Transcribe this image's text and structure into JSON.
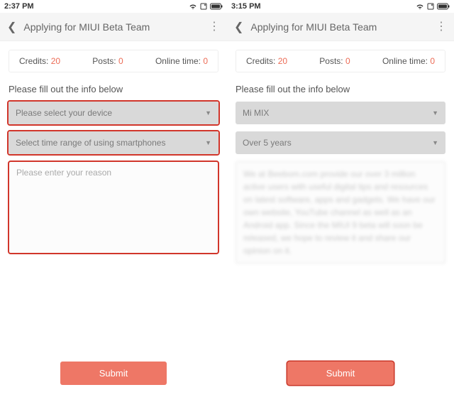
{
  "left": {
    "statusbar": {
      "time": "2:37 PM"
    },
    "header": {
      "title": "Applying for MIUI Beta Team"
    },
    "stats": {
      "credits_label": "Credits:",
      "credits_value": "20",
      "posts_label": "Posts:",
      "posts_value": "0",
      "online_label": "Online time:",
      "online_value": "0"
    },
    "section_label": "Please fill out the info below",
    "device_select": "Please select your device",
    "time_select": "Select time range of using smartphones",
    "reason_placeholder": "Please enter your reason",
    "submit": "Submit"
  },
  "right": {
    "statusbar": {
      "time": "3:15 PM"
    },
    "header": {
      "title": "Applying for MIUI Beta Team"
    },
    "stats": {
      "credits_label": "Credits:",
      "credits_value": "20",
      "posts_label": "Posts:",
      "posts_value": "0",
      "online_label": "Online time:",
      "online_value": "0"
    },
    "section_label": "Please fill out the info below",
    "device_select": "Mi MIX",
    "time_select": "Over 5 years",
    "reason_filled": "We at Beebom.com provide our over 3 million active users with useful digital tips and resources on latest software, apps and gadgets. We have our own website, YouTube channel as well as an Android app. Since the MIUI 9 beta will soon be released, we hope to review it and share our opinion on it.",
    "submit": "Submit"
  }
}
